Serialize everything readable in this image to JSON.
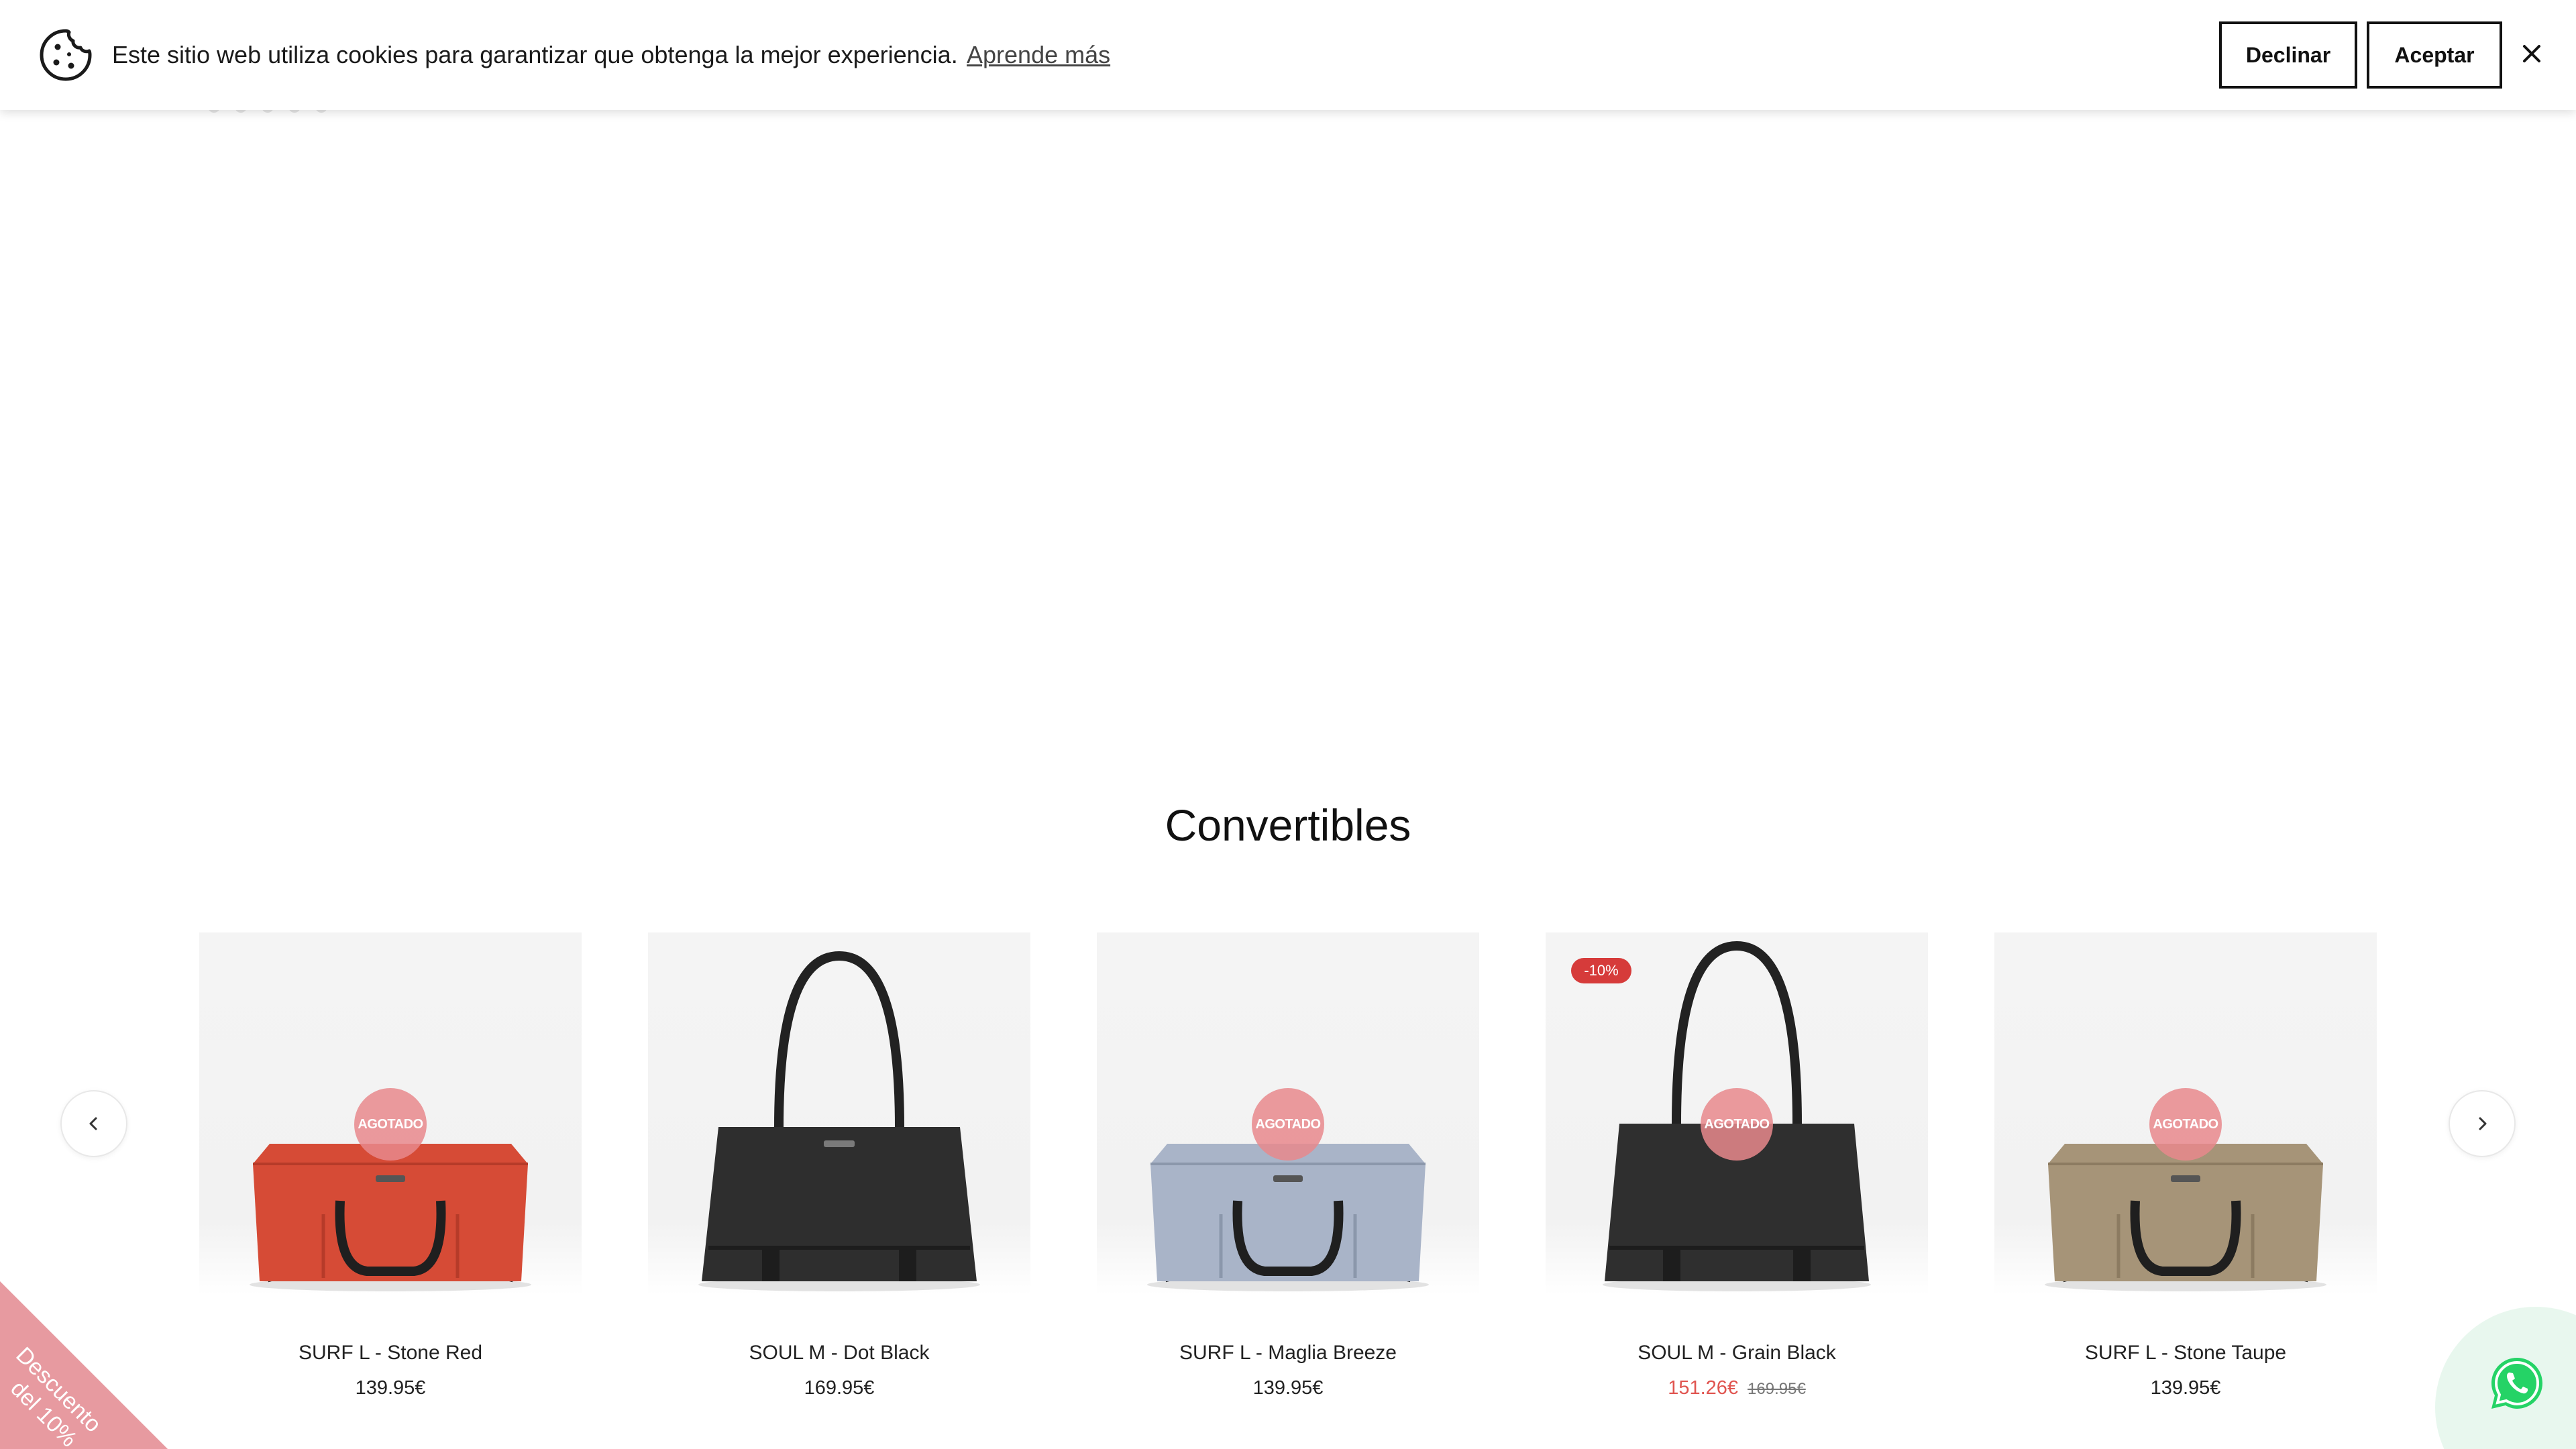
{
  "cookie_banner": {
    "message": "Este sitio web utiliza cookies para garantizar que obtenga la mejor experiencia.",
    "learn_more": "Aprende más",
    "decline_label": "Declinar",
    "accept_label": "Aceptar",
    "close_icon": "close-icon",
    "cookie_icon": "cookie-icon"
  },
  "section": {
    "title": "Convertibles"
  },
  "products": [
    {
      "name": "SURF L - Stone Red",
      "price": "139.95€",
      "badge": "AGOTADO",
      "color": "#d64b36"
    },
    {
      "name": "SOUL M - Dot Black",
      "price": "169.95€",
      "color": "#2e2e2e"
    },
    {
      "name": "SURF L - Maglia Breeze",
      "price": "139.95€",
      "badge": "AGOTADO",
      "color": "#a9b4c8"
    },
    {
      "name": "SOUL M - Grain Black",
      "price": "151.26€",
      "old_price": "169.95€",
      "discount": "-10%",
      "badge": "AGOTADO",
      "color": "#2f2f2f"
    },
    {
      "name": "SURF L - Stone Taupe",
      "price": "139.95€",
      "badge": "AGOTADO",
      "color": "#a69478"
    }
  ],
  "carousel": {
    "prev_icon": "chevron-left-icon",
    "next_icon": "chevron-right-icon"
  },
  "promo": {
    "line1": "Descuento",
    "line2": "del 10%",
    "color": "#e79aa0"
  },
  "whatsapp": {
    "icon": "whatsapp-icon",
    "color": "#25d366"
  }
}
